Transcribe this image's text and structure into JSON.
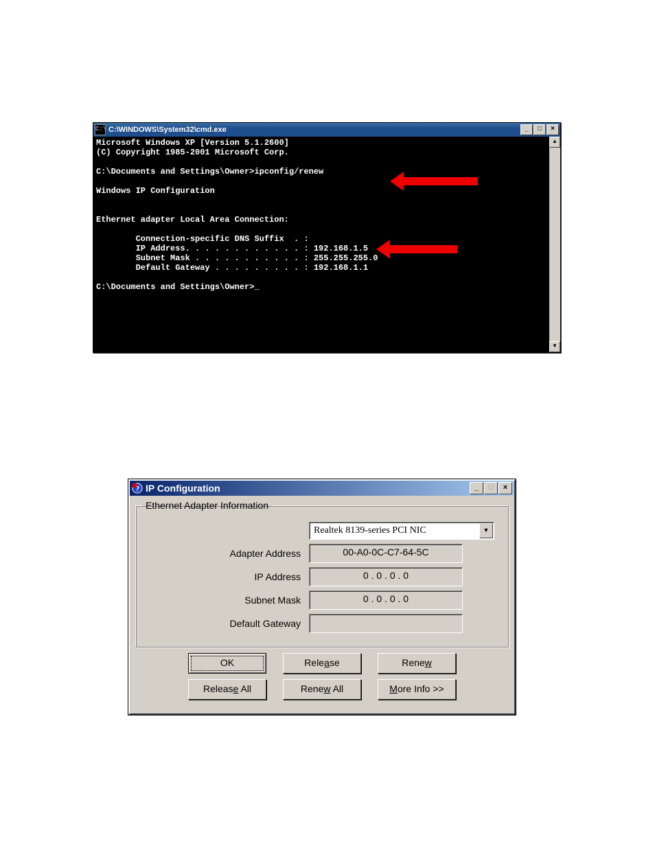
{
  "cmd": {
    "title": "C:\\WINDOWS\\System32\\cmd.exe",
    "icon_label": "C:\\",
    "minimize": "_",
    "maximize": "□",
    "close": "×",
    "scroll_up": "▲",
    "scroll_down": "▼",
    "lines": {
      "l1": "Microsoft Windows XP [Version 5.1.2600]",
      "l2": "(C) Copyright 1985-2001 Microsoft Corp.",
      "l3": "",
      "l4": "C:\\Documents and Settings\\Owner>ipconfig/renew",
      "l5": "",
      "l6": "Windows IP Configuration",
      "l7": "",
      "l8": "",
      "l9": "Ethernet adapter Local Area Connection:",
      "l10": "",
      "l11": "        Connection-specific DNS Suffix  . :",
      "l12": "        IP Address. . . . . . . . . . . . : 192.168.1.5",
      "l13": "        Subnet Mask . . . . . . . . . . . : 255.255.255.0",
      "l14": "        Default Gateway . . . . . . . . . : 192.168.1.1",
      "l15": "",
      "l16": "C:\\Documents and Settings\\Owner>_"
    }
  },
  "ipcfg": {
    "title": "IP Configuration",
    "minimize": "_",
    "maximize": "□",
    "close": "×",
    "group_label": "Ethernet  Adapter Information",
    "adapter_selected": "Realtek 8139-series PCI NIC",
    "combo_arrow": "▼",
    "labels": {
      "adapter_address": "Adapter Address",
      "ip_address": "IP Address",
      "subnet_mask": "Subnet Mask",
      "default_gateway": "Default Gateway"
    },
    "values": {
      "adapter_address": "00-A0-0C-C7-64-5C",
      "ip_address": "0 . 0 . 0 . 0",
      "subnet_mask": "0 . 0 . 0 . 0",
      "default_gateway": ""
    },
    "buttons": {
      "ok": "OK",
      "release_pre": "Rele",
      "release_u": "a",
      "release_post": "se",
      "renew_pre": "Rene",
      "renew_u": "w",
      "renew_post": "",
      "release_all_pre": "Releas",
      "release_all_u": "e",
      "release_all_post": " All",
      "renew_all_pre": "Rene",
      "renew_all_u": "w",
      "renew_all_post": " All",
      "more_pre": "",
      "more_u": "M",
      "more_post": "ore Info >>"
    }
  }
}
